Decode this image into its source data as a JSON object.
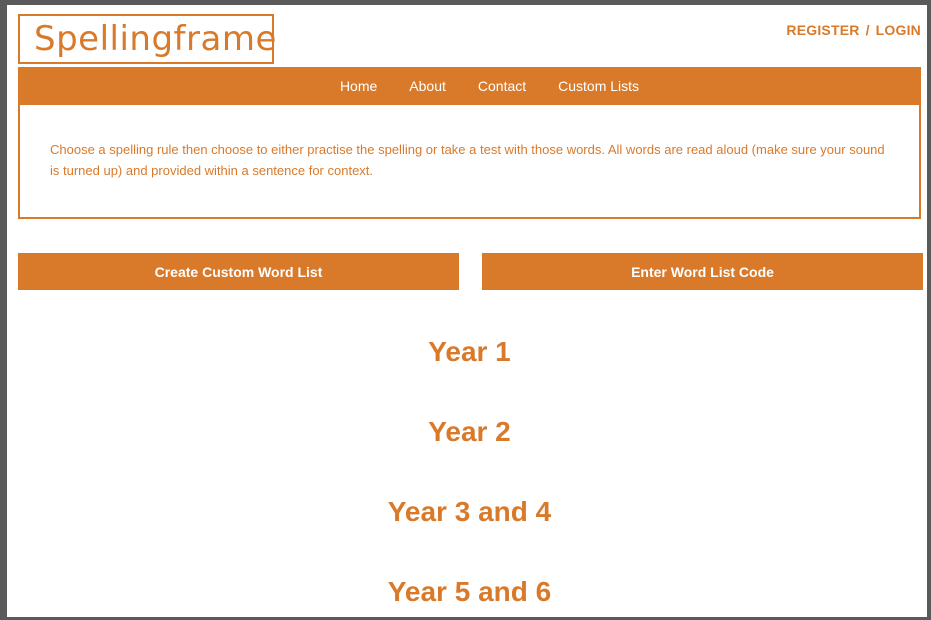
{
  "header": {
    "logo_text": "Spellingframe",
    "register_label": "REGISTER",
    "separator": "/",
    "login_label": "LOGIN"
  },
  "nav": {
    "items": [
      {
        "label": "Home"
      },
      {
        "label": "About"
      },
      {
        "label": "Contact"
      },
      {
        "label": "Custom Lists"
      }
    ]
  },
  "intro": {
    "text": "Choose a spelling rule then choose to either practise the spelling or take a test with those words. All words are read aloud (make sure your sound is turned up) and provided within a sentence for context."
  },
  "actions": {
    "create_label": "Create Custom Word List",
    "code_label": "Enter Word List Code"
  },
  "years": [
    {
      "label": "Year 1"
    },
    {
      "label": "Year 2"
    },
    {
      "label": "Year 3 and 4"
    },
    {
      "label": "Year 5 and 6"
    }
  ],
  "colors": {
    "accent": "#d97a2b",
    "frame": "#5a5a5a"
  }
}
